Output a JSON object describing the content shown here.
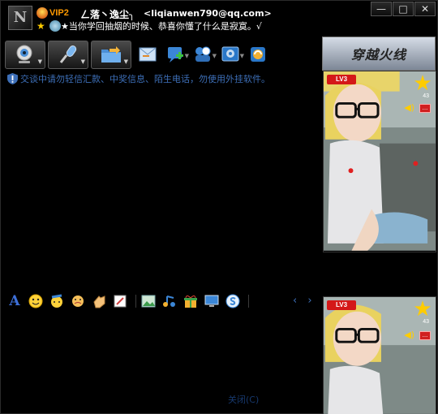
{
  "titlebar": {
    "avatar_letter": "N",
    "vip_label": "VIP2",
    "nickname": "ㄥ落丶逸尘╮",
    "email": "<liqianwen790@qq.com>",
    "signature": "★当你学回抽烟的时候、恭喜你懂了什么是寂寞。√",
    "minimize_label": "—",
    "maximize_label": "□",
    "close_label": "✕"
  },
  "toolbar": {
    "items": [
      {
        "icon": "video-camera-icon"
      },
      {
        "icon": "microphone-icon"
      },
      {
        "icon": "folder-transfer-icon"
      },
      {
        "icon": "email-icon"
      },
      {
        "icon": "add-friend-icon"
      },
      {
        "icon": "group-chat-icon"
      },
      {
        "icon": "application-icon"
      },
      {
        "icon": "qq-software-icon"
      }
    ]
  },
  "ad_banner": {
    "text": "穿越火线"
  },
  "warning": {
    "text": "交谈中请勿轻信汇款、中奖信息、陌生电话，勿使用外挂软件。"
  },
  "profile_photo": {
    "level_label": "LV3",
    "star_count": "43",
    "close_label": "..."
  },
  "format_toolbar": {
    "font_label": "A",
    "prev_arrow": "‹",
    "next_arrow": "›"
  },
  "footer": {
    "close_label": "关闭(C)"
  },
  "colors": {
    "background": "#000000",
    "warning_text": "#3d6fb8",
    "vip": "#ff9a00",
    "level_badge": "#d41818"
  }
}
